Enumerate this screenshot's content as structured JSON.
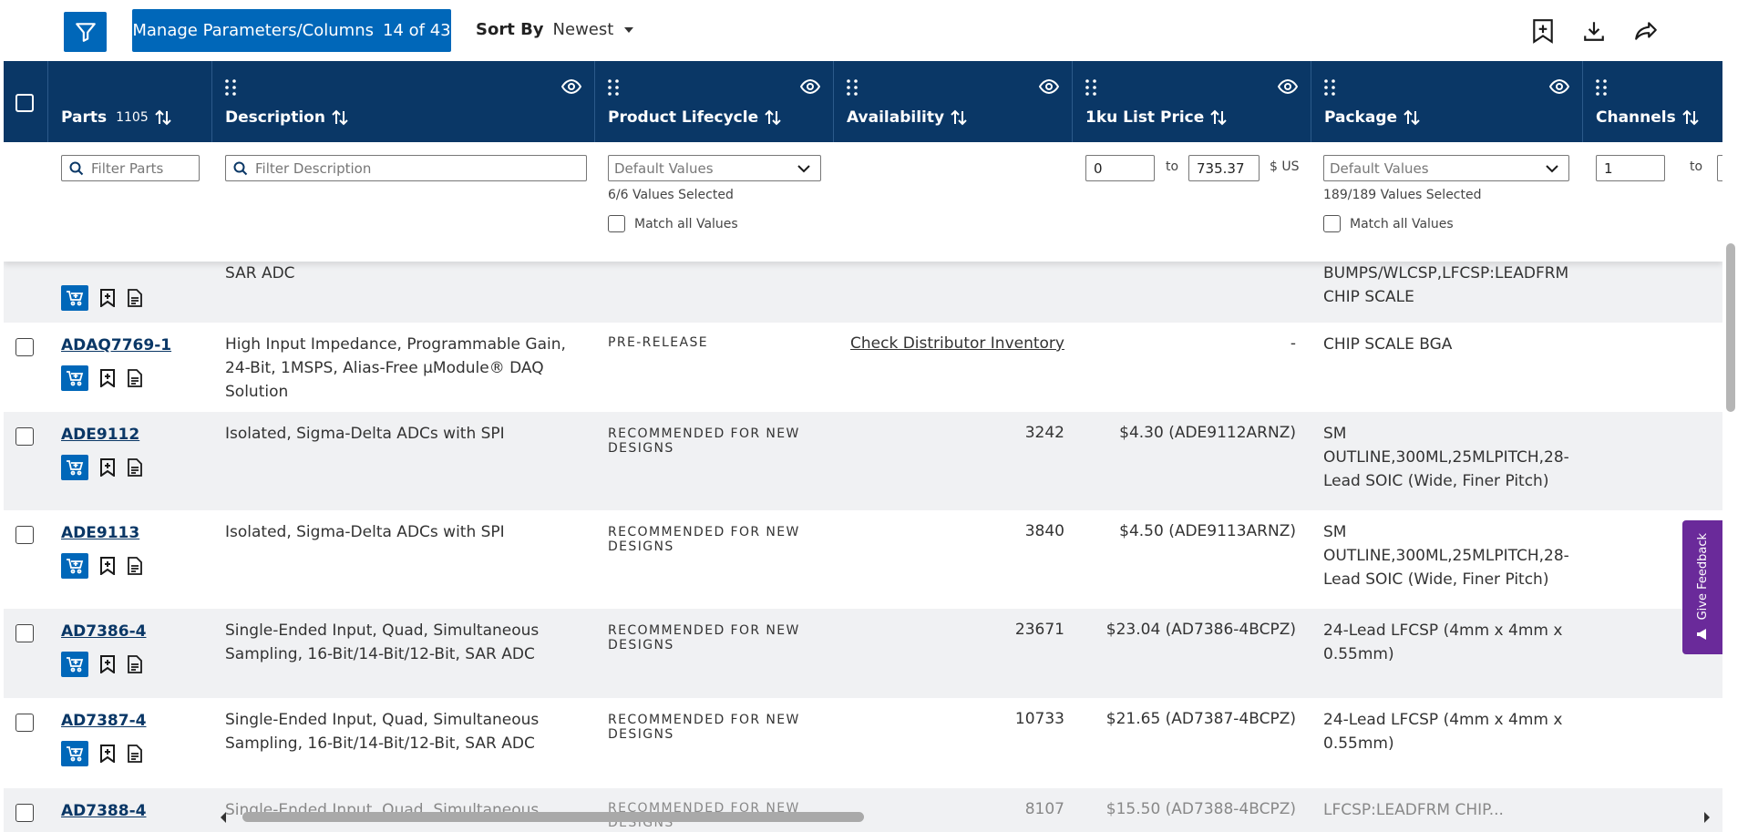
{
  "toolbar": {
    "manage_label": "Manage Parameters/Columns",
    "manage_count": "14 of 43",
    "sort_label": "Sort By",
    "sort_value": "Newest"
  },
  "columns": {
    "parts": {
      "label": "Parts",
      "count": "1105"
    },
    "description": {
      "label": "Description"
    },
    "lifecycle": {
      "label": "Product Lifecycle"
    },
    "availability": {
      "label": "Availability"
    },
    "price": {
      "label": "1ku List Price"
    },
    "package": {
      "label": "Package"
    },
    "channels": {
      "label": "Channels"
    }
  },
  "filters": {
    "parts_placeholder": "Filter Parts",
    "description_placeholder": "Filter Description",
    "lifecycle_select": "Default Values",
    "lifecycle_note": "6/6 Values Selected",
    "match_all": "Match all Values",
    "price_min": "0",
    "price_to": "to",
    "price_max": "735.37",
    "price_unit": "$ US",
    "package_select": "Default Values",
    "package_note": "189/189 Values Selected",
    "channels_min": "1",
    "channels_to": "to"
  },
  "rows": [
    {
      "part": "",
      "description": "SAR ADC",
      "lifecycle": "",
      "availability": "",
      "price": "",
      "package": "BUMPS/WLCSP,LFCSP:LEADFRM CHIP SCALE"
    },
    {
      "part": "ADAQ7769-1",
      "description": "High Input Impedance, Programmable Gain, 24-Bit, 1MSPS, Alias-Free µModule® DAQ Solution",
      "lifecycle": "PRE-RELEASE",
      "availability": "Check Distributor Inventory",
      "price": "-",
      "package": "CHIP SCALE BGA"
    },
    {
      "part": "ADE9112",
      "description": "Isolated, Sigma-Delta ADCs with SPI",
      "lifecycle": "RECOMMENDED FOR NEW DESIGNS",
      "availability": "3242",
      "price": "$4.30 (ADE9112ARNZ)",
      "package": "SM OUTLINE,300ML,25MLPITCH,28-Lead SOIC (Wide, Finer Pitch)"
    },
    {
      "part": "ADE9113",
      "description": "Isolated, Sigma-Delta ADCs with SPI",
      "lifecycle": "RECOMMENDED FOR NEW DESIGNS",
      "availability": "3840",
      "price": "$4.50 (ADE9113ARNZ)",
      "package": "SM OUTLINE,300ML,25MLPITCH,28-Lead SOIC (Wide, Finer Pitch)"
    },
    {
      "part": "AD7386-4",
      "description": "Single-Ended Input, Quad, Simultaneous Sampling, 16-Bit/14-Bit/12-Bit, SAR ADC",
      "lifecycle": "RECOMMENDED FOR NEW DESIGNS",
      "availability": "23671",
      "price": "$23.04 (AD7386-4BCPZ)",
      "package": "24-Lead LFCSP (4mm x 4mm x 0.55mm)"
    },
    {
      "part": "AD7387-4",
      "description": "Single-Ended Input, Quad, Simultaneous Sampling, 16-Bit/14-Bit/12-Bit, SAR ADC",
      "lifecycle": "RECOMMENDED FOR NEW DESIGNS",
      "availability": "10733",
      "price": "$21.65 (AD7387-4BCPZ)",
      "package": "24-Lead LFCSP (4mm x 4mm x 0.55mm)"
    },
    {
      "part": "AD7388-4",
      "description": "Single-Ended Input, Quad, Simultaneous...",
      "lifecycle": "RECOMMENDED FOR NEW DESIGNS",
      "availability": "8107",
      "price": "$15.50 (AD7388-4BCPZ)",
      "package": "LFCSP:LEADFRM CHIP..."
    }
  ],
  "feedback": {
    "label": "Give Feedback"
  },
  "icons": {
    "filter": "filter-icon",
    "save": "bookmark-add-icon",
    "download": "download-icon",
    "share": "share-icon",
    "cart": "add-to-cart-icon",
    "datasheet": "document-icon"
  }
}
